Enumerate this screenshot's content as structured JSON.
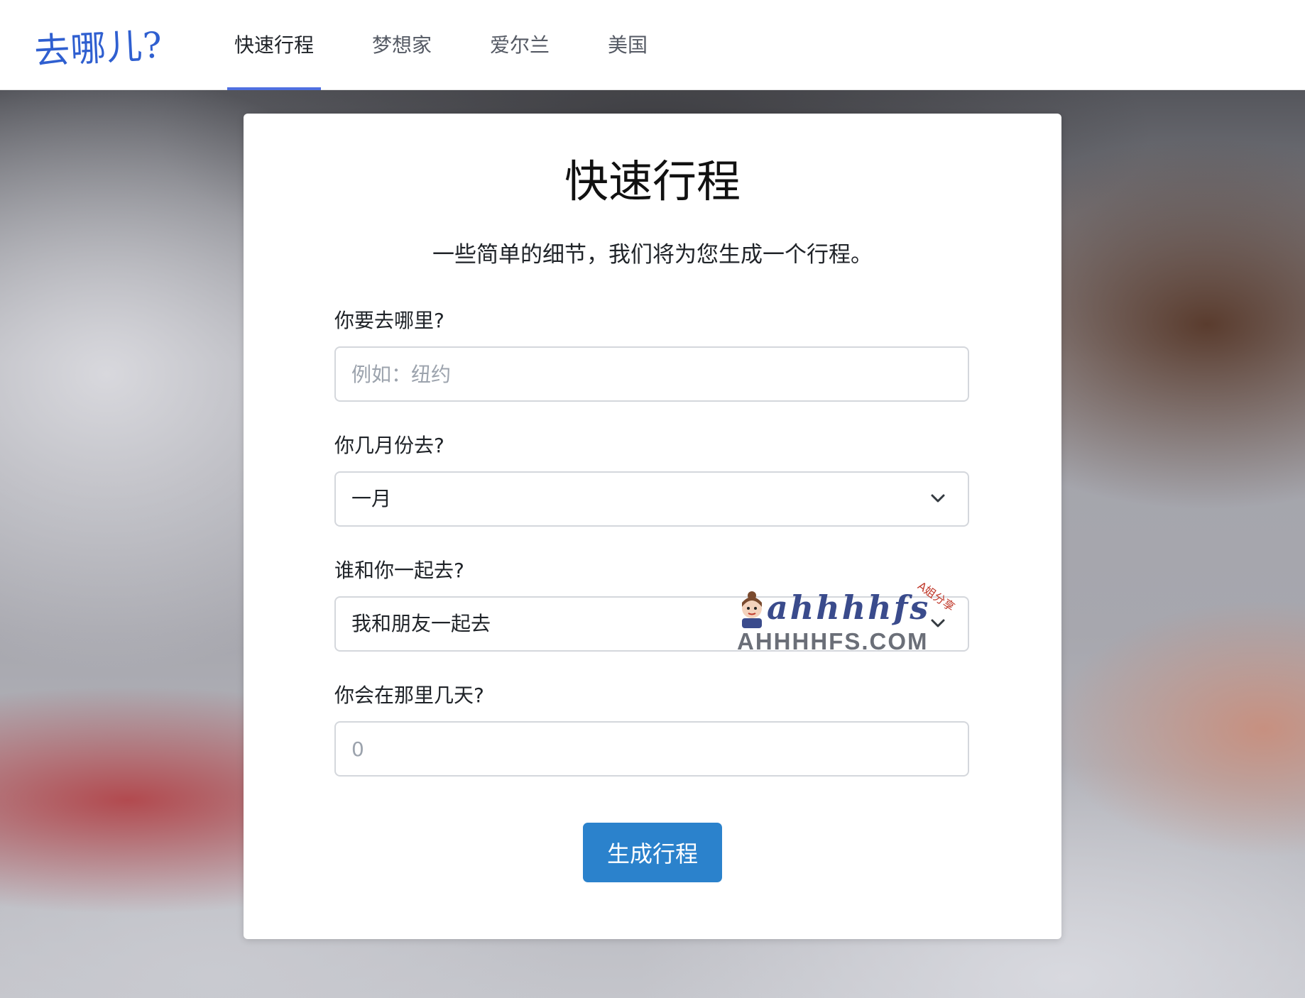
{
  "navbar": {
    "brand": "去哪儿?",
    "items": [
      {
        "label": "快速行程",
        "active": true
      },
      {
        "label": "梦想家",
        "active": false
      },
      {
        "label": "爱尔兰",
        "active": false
      },
      {
        "label": "美国",
        "active": false
      }
    ]
  },
  "form": {
    "title": "快速行程",
    "subtitle": "一些简单的细节，我们将为您生成一个行程。",
    "destination": {
      "label": "你要去哪里?",
      "placeholder": "例如：纽约",
      "value": ""
    },
    "month": {
      "label": "你几月份去?",
      "selected": "一月"
    },
    "companions": {
      "label": "谁和你一起去?",
      "selected": "我和朋友一起去"
    },
    "days": {
      "label": "你会在那里几天?",
      "placeholder": "0",
      "value": ""
    },
    "submit_label": "生成行程"
  },
  "watermark": {
    "script": "ahhhhfs",
    "small": "A姐分享",
    "domain": "AHHHHFS.COM"
  },
  "colors": {
    "brand": "#2f5fd0",
    "active_tab_underline": "#4f6fe0",
    "button": "#2b82cc"
  },
  "icons": {
    "select_arrow": "chevron-down-icon"
  }
}
